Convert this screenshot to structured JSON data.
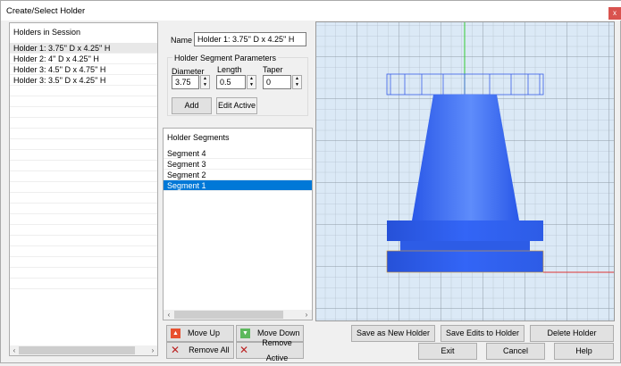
{
  "window": {
    "title": "Create/Select Holder",
    "close": "x"
  },
  "holders": {
    "header": "Holders in Session",
    "items": [
      "Holder 1: 3.75'' D x 4.25'' H",
      "Holder 2: 4'' D x 4.25'' H",
      "Holder 3: 4.5'' D x 4.75'' H",
      "Holder 3: 3.5'' D x 4.25'' H"
    ]
  },
  "name": {
    "label": "Name",
    "value": "Holder 1: 3.75'' D x 4.25'' H"
  },
  "params": {
    "title": "Holder Segment Parameters",
    "diameter_label": "Diameter",
    "diameter": "3.75",
    "length_label": "Length",
    "length": "0.5",
    "taper_label": "Taper",
    "taper": "0",
    "add": "Add",
    "edit_active": "Edit Active"
  },
  "segments": {
    "header": "Holder Segments",
    "items": [
      "Segment 4",
      "Segment 3",
      "Segment 2",
      "Segment 1"
    ],
    "selected": "Segment 1"
  },
  "buttons": {
    "move_up": "Move Up",
    "move_down": "Move Down",
    "remove_all": "Remove All",
    "remove_active": "Remove Active",
    "save_new": "Save as New Holder",
    "save_edits": "Save Edits to Holder",
    "delete": "Delete Holder",
    "exit": "Exit",
    "cancel": "Cancel",
    "help": "Help"
  },
  "colors": {
    "holder": "#2f63f0",
    "grid_bg": "#dbe9f6",
    "selection": "#0078d7"
  }
}
